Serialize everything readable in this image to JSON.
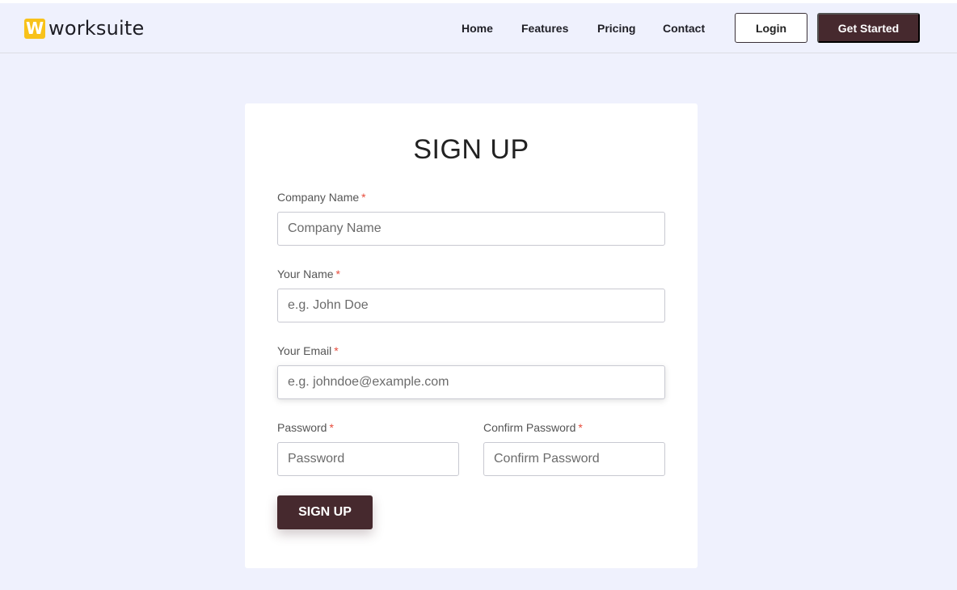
{
  "header": {
    "logo_mark": "W",
    "logo_text": "worksuite",
    "nav": {
      "home": "Home",
      "features": "Features",
      "pricing": "Pricing",
      "contact": "Contact"
    },
    "login_label": "Login",
    "get_started_label": "Get Started"
  },
  "form": {
    "title": "SIGN UP",
    "required_mark": "*",
    "company": {
      "label": "Company Name",
      "placeholder": "Company Name",
      "value": ""
    },
    "name": {
      "label": "Your Name",
      "placeholder": "e.g. John Doe",
      "value": ""
    },
    "email": {
      "label": "Your Email",
      "placeholder": "e.g. johndoe@example.com",
      "value": ""
    },
    "password": {
      "label": "Password",
      "placeholder": "Password",
      "value": ""
    },
    "confirm_password": {
      "label": "Confirm Password",
      "placeholder": "Confirm Password",
      "value": ""
    },
    "submit_label": "SIGN UP"
  },
  "colors": {
    "page_bg": "#eff1fd",
    "brand_dark": "#46292e",
    "logo_yellow": "#f8c21a",
    "required_red": "#e74c3c"
  },
  "icons": [
    "worksuite-logo-icon"
  ]
}
